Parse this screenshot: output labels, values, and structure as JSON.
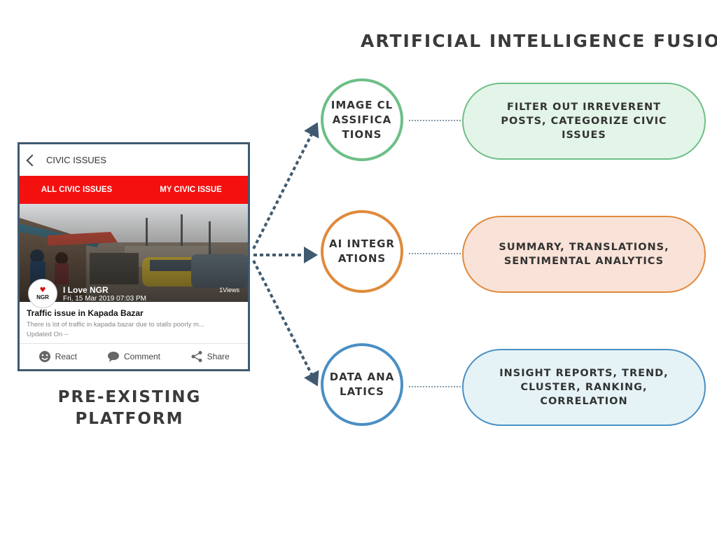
{
  "title": "ARTIFICIAL INTELLIGENCE FUSION",
  "platform": {
    "title_line1": "PRE-EXISTING",
    "title_line2": "PLATFORM"
  },
  "phone": {
    "header_title": "CIVIC ISSUES",
    "tab_all": "ALL CIVIC ISSUES",
    "tab_my": "MY CIVIC ISSUE",
    "avatar_logo_text": "NGR",
    "poster_name": "I Love NGR",
    "poster_date": "Fri, 15 Mar 2019 07:03 PM",
    "views": "1Views",
    "post_title": "Traffic issue in Kapada Bazar",
    "post_body": "There is lot of traffic in kapada bazar due to stalls poorly m...",
    "post_updated": "Updated On --",
    "action_react": "React",
    "action_comment": "Comment",
    "action_share": "Share",
    "tab_bar_color": "#f51010"
  },
  "nodes": [
    {
      "label": "IMAGE CLASSIFICATIONS",
      "color": "#6dbf86"
    },
    {
      "label": "AI INTEGRATIONS",
      "color": "#e08a3c"
    },
    {
      "label": "DATA ANALATICS",
      "color": "#4a8fc4"
    }
  ],
  "outputs": [
    {
      "text": "FILTER OUT IRREVERENT POSTS, CATEGORIZE  CIVIC ISSUES",
      "fill": "#e3f5e8"
    },
    {
      "text": "SUMMARY, TRANSLATIONS, SENTIMENTAL ANALYTICS",
      "fill": "#f9e2d7"
    },
    {
      "text": "INSIGHT REPORTS, TREND, CLUSTER, RANKING, CORRELATION",
      "fill": "#e5f3f6"
    }
  ],
  "arrow_color": "#3f5a70"
}
